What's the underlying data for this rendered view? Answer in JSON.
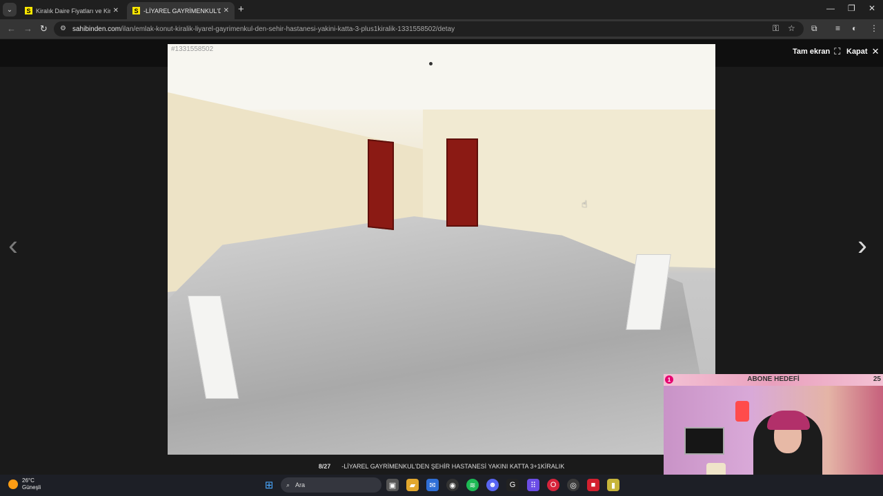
{
  "browser": {
    "tabs": [
      {
        "title": "Kiralık Daire Fiyatları ve Kiralık E",
        "favicon": "S",
        "active": false
      },
      {
        "title": "-LİYAREL GAYRİMENKUL'DEN Ş",
        "favicon": "S",
        "active": true
      }
    ],
    "url_host": "sahibinden.com",
    "url_path": "/ilan/emlak-konut-kiralik-liyarel-gayrimenkul-den-sehir-hastanesi-yakini-katta-3-plus1kiralik-1331558502/detay"
  },
  "viewer": {
    "listing_id": "#1331558502",
    "fullscreen_label": "Tam ekran",
    "close_label": "Kapat",
    "counter": "8/27",
    "caption": "-LİYAREL GAYRİMENKUL'DEN ŞEHİR HASTANESİ YAKINI KATTA 3+1KİRALIK"
  },
  "stream_overlay": {
    "badge": "1",
    "title": "ABONE HEDEFİ",
    "goal": "25"
  },
  "taskbar": {
    "temperature": "26°C",
    "condition": "Güneşli",
    "search_label": "Ara",
    "accent": "#ffe800"
  }
}
